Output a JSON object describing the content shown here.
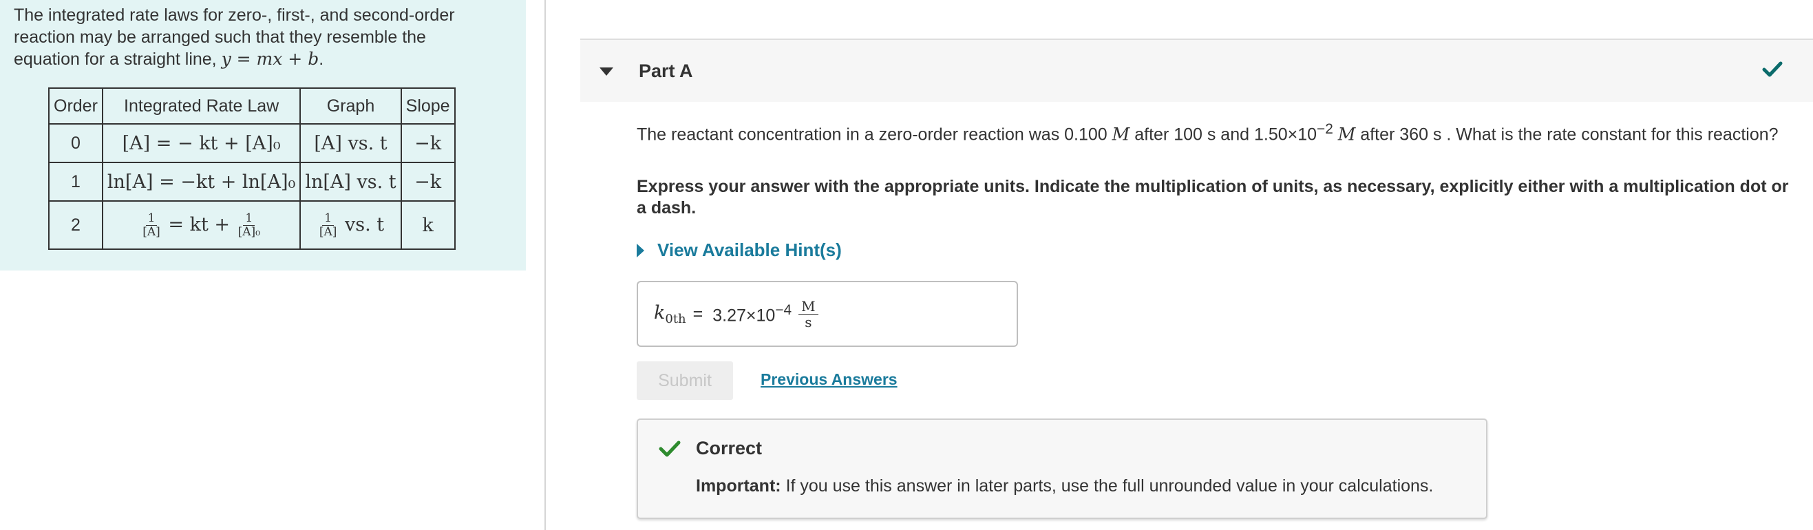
{
  "intro": {
    "text": "The integrated rate laws for zero-, first-, and second-order reaction may be arranged such that they resemble the equation for a straight line,",
    "line_equation": "y = mx + b",
    "table": {
      "headers": [
        "Order",
        "Integrated Rate Law",
        "Graph",
        "Slope"
      ],
      "rows": [
        {
          "order": "0",
          "law": "[A] = − kt + [A]₀",
          "graph": "[A] vs. t",
          "slope": "−k"
        },
        {
          "order": "1",
          "law": "ln[A] = −kt + ln[A]₀",
          "graph": "ln[A] vs. t",
          "slope": "−k"
        },
        {
          "order": "2",
          "law_numerator": "1",
          "law_denominator": "[A]",
          "law_middle": "= kt +",
          "law_numerator2": "1",
          "law_denominator2": "[A]₀",
          "graph_numerator": "1",
          "graph_denominator": "[A]",
          "graph_suffix": "vs. t",
          "slope": "k"
        }
      ]
    }
  },
  "part": {
    "title": "Part A",
    "status_icon": "checkmark-icon",
    "question_pre": "The reactant concentration in a zero-order reaction was 0.100",
    "unit_M": "M",
    "question_mid": "after 100 s and 1.50×10",
    "question_exp": "−2",
    "question_post": "after 360 s . What is the rate constant for this reaction?",
    "instruction": "Express your answer with the appropriate units. Indicate the multiplication of units, as necessary, explicitly either with a multiplication dot or a dash.",
    "hint_label": "View Available Hint(s)",
    "answer": {
      "variable": "k",
      "subscript": "0th",
      "equals": "=",
      "value": "3.27×10",
      "exponent": "−4",
      "unit_numerator": "M",
      "unit_denominator": "s"
    },
    "submit_label": "Submit",
    "previous_answers_label": "Previous Answers",
    "feedback": {
      "title": "Correct",
      "important_label": "Important:",
      "message": "If you use this answer in later parts, use the full unrounded value in your calculations."
    }
  },
  "colors": {
    "intro_bg": "#e3f4f4",
    "link": "#1a7b9c",
    "check_header": "#0b6b6b",
    "check_feedback": "#2e8b2e"
  }
}
